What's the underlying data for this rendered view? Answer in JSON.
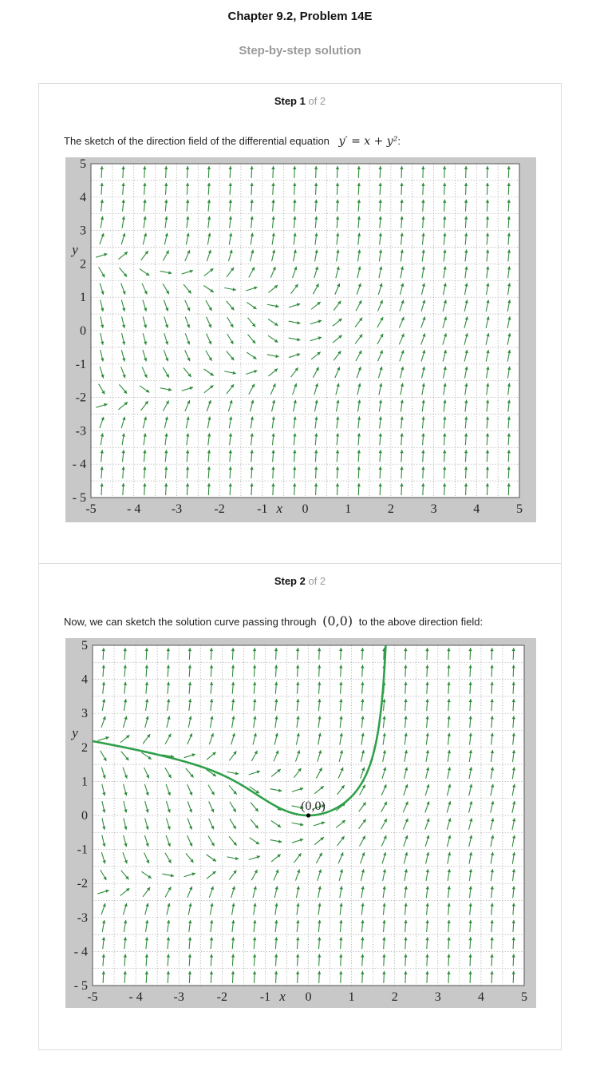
{
  "header": {
    "title": "Chapter 9.2, Problem 14E",
    "subtitle": "Step-by-step solution"
  },
  "steps": [
    {
      "label": "Step 1",
      "of": "of 2",
      "text": "The sketch of the direction field of the differential equation",
      "equation": "y′ = x + y²",
      "equation_suffix": ":"
    },
    {
      "label": "Step 2",
      "of": "of 2",
      "text_before": "Now, we can sketch the solution curve passing through",
      "point": "(0,0)",
      "text_after": "to the above direction field:"
    }
  ],
  "chart_data": [
    {
      "type": "direction-field",
      "equation": "y' = x + y^2",
      "xlabel": "x",
      "ylabel": "y",
      "xlim": [
        -5,
        5
      ],
      "ylim": [
        -5,
        5
      ],
      "x_ticks": [
        "-5",
        "- 4",
        "-3",
        "-2",
        "-1",
        "0",
        "1",
        "2",
        "3",
        "4",
        "5"
      ],
      "y_ticks": [
        "5",
        "4",
        "3",
        "2",
        "1",
        "0",
        "-1",
        "-2",
        "-3",
        "- 4",
        "- 5"
      ],
      "grid": true,
      "arrow_color": "#2e8b3a"
    },
    {
      "type": "direction-field",
      "equation": "y' = x + y^2",
      "xlabel": "x",
      "ylabel": "y",
      "xlim": [
        -5,
        5
      ],
      "ylim": [
        -5,
        5
      ],
      "x_ticks": [
        "-5",
        "- 4",
        "-3",
        "-2",
        "-1",
        "0",
        "1",
        "2",
        "3",
        "4",
        "5"
      ],
      "y_ticks": [
        "5",
        "4",
        "3",
        "2",
        "1",
        "0",
        "-1",
        "-2",
        "-3",
        "- 4",
        "- 5"
      ],
      "grid": true,
      "arrow_color": "#2e8b3a",
      "curve_color": "#2fa04a",
      "solution_point": {
        "x": 0,
        "y": 0,
        "label": "(0,0)"
      }
    }
  ]
}
